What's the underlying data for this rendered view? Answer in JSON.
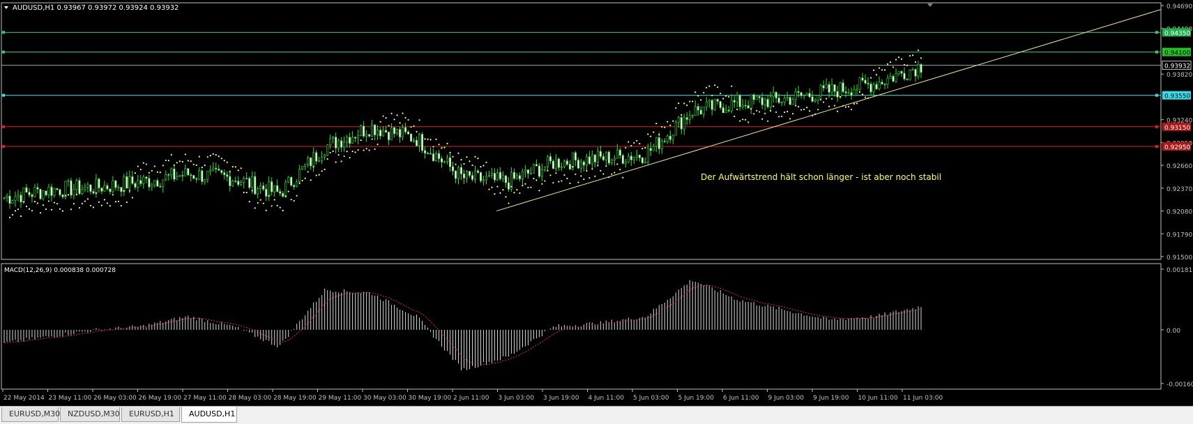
{
  "symbol_header": "AUDUSD,H1  0.93967 0.93972 0.93924 0.93932",
  "indicator_header": "MACD(12,26,9) 0.000838 0.000728",
  "annotation": "Der Aufwärtstrend hält schon länger - ist aber noch stabil",
  "price_axis": {
    "ticks": [
      "0.94690",
      "0.94400",
      "0.93820",
      "0.93240",
      "0.92950",
      "0.92660",
      "0.92370",
      "0.92080",
      "0.91790",
      "0.91500"
    ],
    "current_price": "0.93932"
  },
  "levels": [
    {
      "label": "0.94350",
      "price": 0.9435,
      "color": "#26d07a",
      "label_bg": "#1fb24f",
      "label_fg": "#ffffff"
    },
    {
      "label": "0.94100",
      "price": 0.941,
      "color": "#26d07a",
      "label_bg": "#22c322",
      "label_fg": "#000000"
    },
    {
      "label": "0.93550",
      "price": 0.9355,
      "color": "#30e0ea",
      "label_bg": "#30e0ea",
      "label_fg": "#000000"
    },
    {
      "label": "0.93150",
      "price": 0.9315,
      "color": "#e02020",
      "label_bg": "#b01818",
      "label_fg": "#ffffff"
    },
    {
      "label": "0.92950",
      "price": 0.929,
      "color": "#e02020",
      "label_bg": "#b01818",
      "label_fg": "#ffffff"
    }
  ],
  "macd_axis": {
    "ticks": [
      "0.001813",
      "0.00",
      "-0.001608"
    ]
  },
  "time_axis": [
    "22 May 2014",
    "23 May 11:00",
    "26 May 03:00",
    "26 May 19:00",
    "27 May 11:00",
    "28 May 03:00",
    "28 May 19:00",
    "29 May 11:00",
    "30 May 03:00",
    "30 May 19:00",
    "2 Jun 11:00",
    "3 Jun 03:00",
    "3 Jun 19:00",
    "4 Jun 11:00",
    "5 Jun 03:00",
    "5 Jun 19:00",
    "6 Jun 11:00",
    "9 Jun 03:00",
    "9 Jun 19:00",
    "10 Jun 11:00",
    "11 Jun 03:00"
  ],
  "chart_data": {
    "type": "line",
    "title": "AUDUSD,H1",
    "series": [
      {
        "name": "AUDUSD,H1",
        "x": [
          "22 May 2014",
          "23 May 11:00",
          "26 May 03:00",
          "26 May 19:00",
          "27 May 11:00",
          "28 May 03:00",
          "28 May 19:00",
          "29 May 11:00",
          "30 May 03:00",
          "30 May 19:00",
          "2 Jun 11:00",
          "3 Jun 03:00",
          "3 Jun 19:00",
          "4 Jun 11:00",
          "5 Jun 03:00",
          "5 Jun 19:00",
          "6 Jun 11:00",
          "9 Jun 03:00",
          "9 Jun 19:00",
          "10 Jun 11:00",
          "11 Jun 03:00"
        ],
        "values": [
          0.9225,
          0.9235,
          0.9238,
          0.9245,
          0.9255,
          0.925,
          0.923,
          0.929,
          0.9315,
          0.93,
          0.925,
          0.9245,
          0.927,
          0.9275,
          0.928,
          0.9335,
          0.9345,
          0.935,
          0.936,
          0.937,
          0.9393
        ]
      }
    ],
    "macd": {
      "x": [
        "22 May 2014",
        "23 May 11:00",
        "26 May 03:00",
        "26 May 19:00",
        "27 May 11:00",
        "28 May 03:00",
        "28 May 19:00",
        "29 May 11:00",
        "30 May 03:00",
        "30 May 19:00",
        "2 Jun 11:00",
        "3 Jun 03:00",
        "3 Jun 19:00",
        "4 Jun 11:00",
        "5 Jun 03:00",
        "5 Jun 19:00",
        "6 Jun 11:00",
        "9 Jun 03:00",
        "9 Jun 19:00",
        "10 Jun 11:00",
        "11 Jun 03:00"
      ],
      "values": [
        -0.0004,
        -0.0002,
        0.0,
        0.0001,
        0.0004,
        0.0001,
        -0.0005,
        0.0012,
        0.0011,
        0.0004,
        -0.0012,
        -0.0008,
        0.0001,
        0.0002,
        0.0004,
        0.0015,
        0.0009,
        0.0006,
        0.0003,
        0.0004,
        0.0007
      ]
    },
    "ylim": [
      0.915,
      0.9469
    ],
    "trendline_price": [
      0.9208,
      0.9464
    ]
  }
}
